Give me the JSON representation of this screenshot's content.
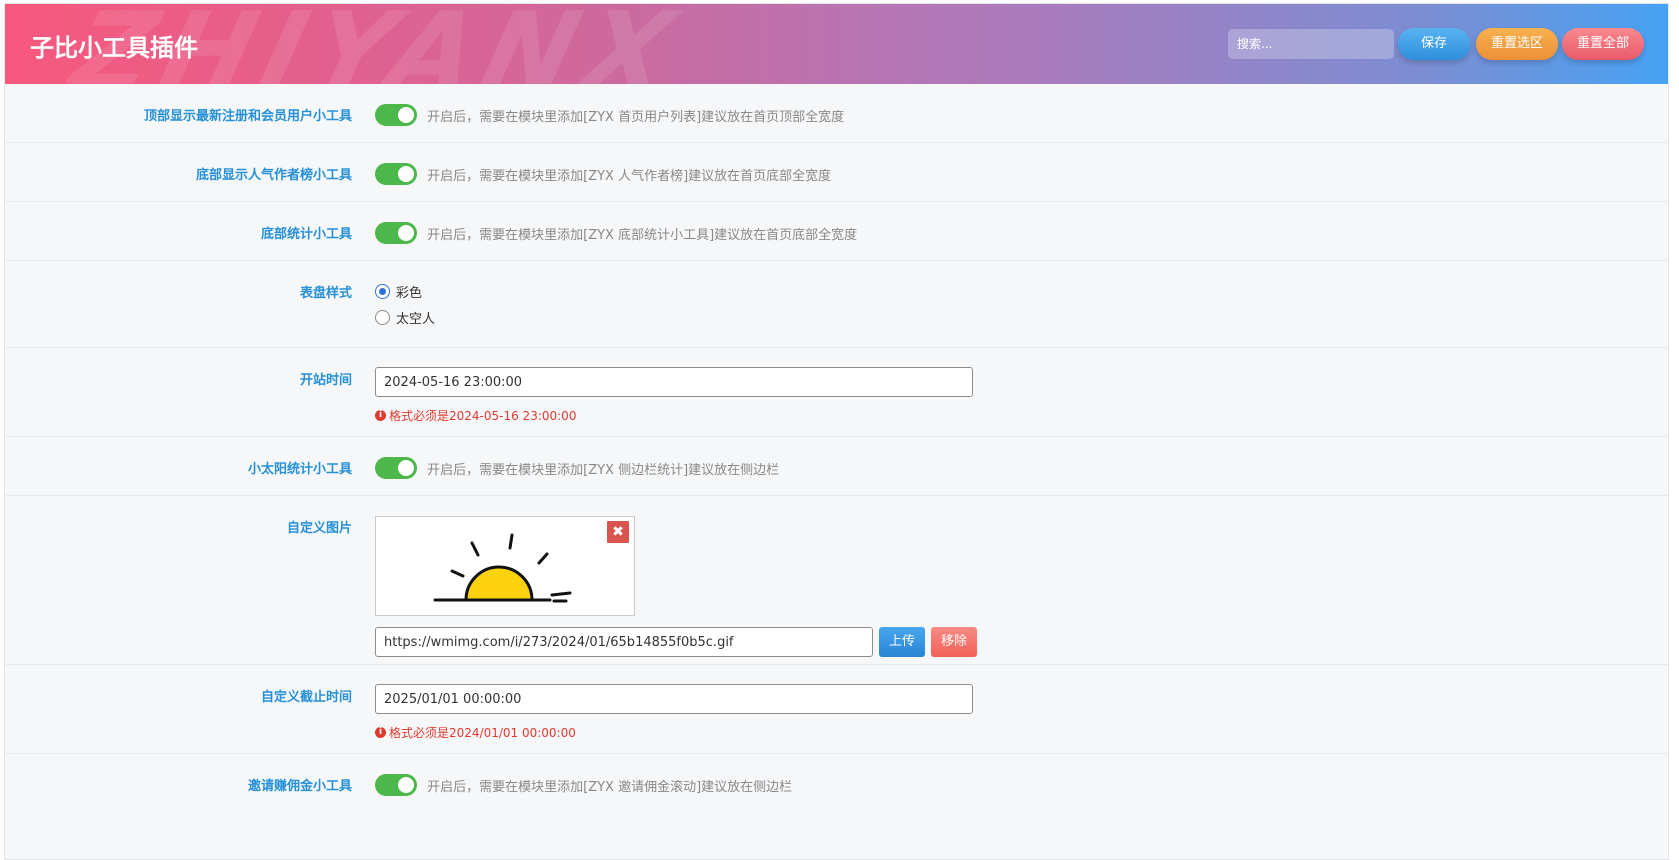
{
  "header": {
    "title": "子比小工具插件",
    "watermark": "ZHIYANX",
    "search_placeholder": "搜索...",
    "save_label": "保存",
    "reset_section_label": "重置选区",
    "reset_all_label": "重置全部"
  },
  "colors": {
    "accent_label": "#2690d8",
    "toggle_on": "#4cb84c",
    "error": "#e03a2f"
  },
  "settings": {
    "top_widget": {
      "label": "顶部显示最新注册和会员用户小工具",
      "enabled": true,
      "hint": "开启后，需要在模块里添加[ZYX 首页用户列表]建议放在首页顶部全宽度"
    },
    "popular_authors": {
      "label": "底部显示人气作者榜小工具",
      "enabled": true,
      "hint": "开启后，需要在模块里添加[ZYX 人气作者榜]建议放在首页底部全宽度"
    },
    "bottom_stats": {
      "label": "底部统计小工具",
      "enabled": true,
      "hint": "开启后，需要在模块里添加[ZYX 底部统计小工具]建议放在首页底部全宽度"
    },
    "dial_style": {
      "label": "表盘样式",
      "options": [
        "彩色",
        "太空人"
      ],
      "selected": "彩色"
    },
    "start_time": {
      "label": "开站时间",
      "value": "2024-05-16 23:00:00",
      "error": "格式必须是2024-05-16 23:00:00"
    },
    "sun_stats": {
      "label": "小太阳统计小工具",
      "enabled": true,
      "hint": "开启后，需要在模块里添加[ZYX 侧边栏统计]建议放在侧边栏"
    },
    "custom_image": {
      "label": "自定义图片",
      "url": "https://wmimg.com/i/273/2024/01/65b14855f0b5c.gif",
      "upload_label": "上传",
      "remove_label": "移除",
      "close_glyph": "✖"
    },
    "custom_deadline": {
      "label": "自定义截止时间",
      "value": "2025/01/01 00:00:00",
      "error": "格式必须是2024/01/01 00:00:00"
    },
    "invite_commission": {
      "label": "邀请赚佣金小工具",
      "enabled": true,
      "hint": "开启后，需要在模块里添加[ZYX 邀请佣金滚动]建议放在侧边栏"
    }
  }
}
